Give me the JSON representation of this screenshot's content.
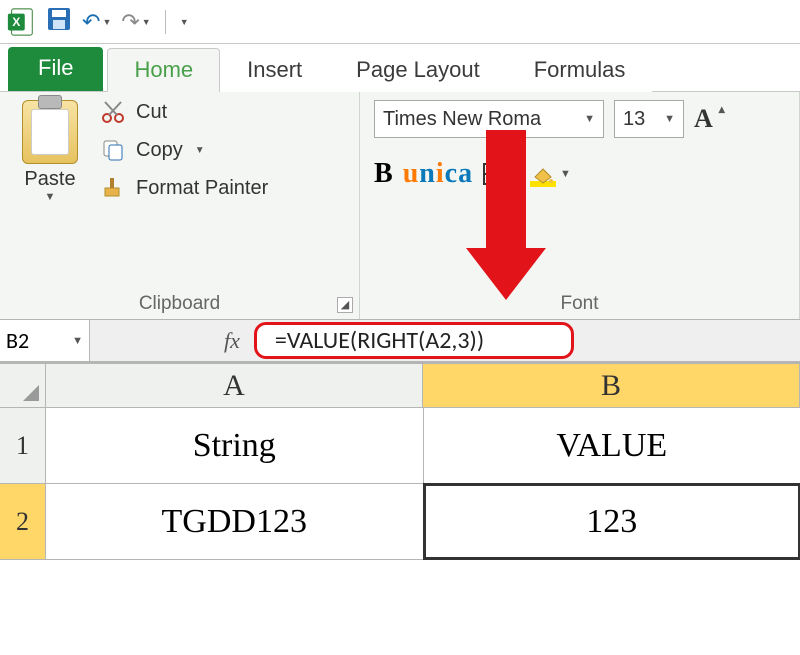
{
  "qat": {
    "app_icon": "excel-icon",
    "save_icon": "save-icon",
    "undo_icon": "undo-icon",
    "redo_icon": "redo-icon",
    "customize_icon": "customize-qat-icon"
  },
  "tabs": {
    "file": "File",
    "home": "Home",
    "insert": "Insert",
    "page_layout": "Page Layout",
    "formulas": "Formulas"
  },
  "clipboard": {
    "paste": "Paste",
    "cut": "Cut",
    "copy": "Copy",
    "format_painter": "Format Painter",
    "group_label": "Clipboard"
  },
  "font": {
    "name": "Times New Roma",
    "size": "13",
    "bold_icon": "B",
    "brand_u": "u",
    "brand_n": "n",
    "brand_i": "i",
    "brand_c": "c",
    "brand_a": "a",
    "group_label": "Font"
  },
  "formula_bar": {
    "name_box": "B2",
    "fx_label": "fx",
    "formula": "=VALUE(RIGHT(A2,3))"
  },
  "grid": {
    "col_a": "A",
    "col_b": "B",
    "row1": "1",
    "row2": "2",
    "a1": "String",
    "b1": "VALUE",
    "a2": "TGDD123",
    "b2": "123"
  }
}
